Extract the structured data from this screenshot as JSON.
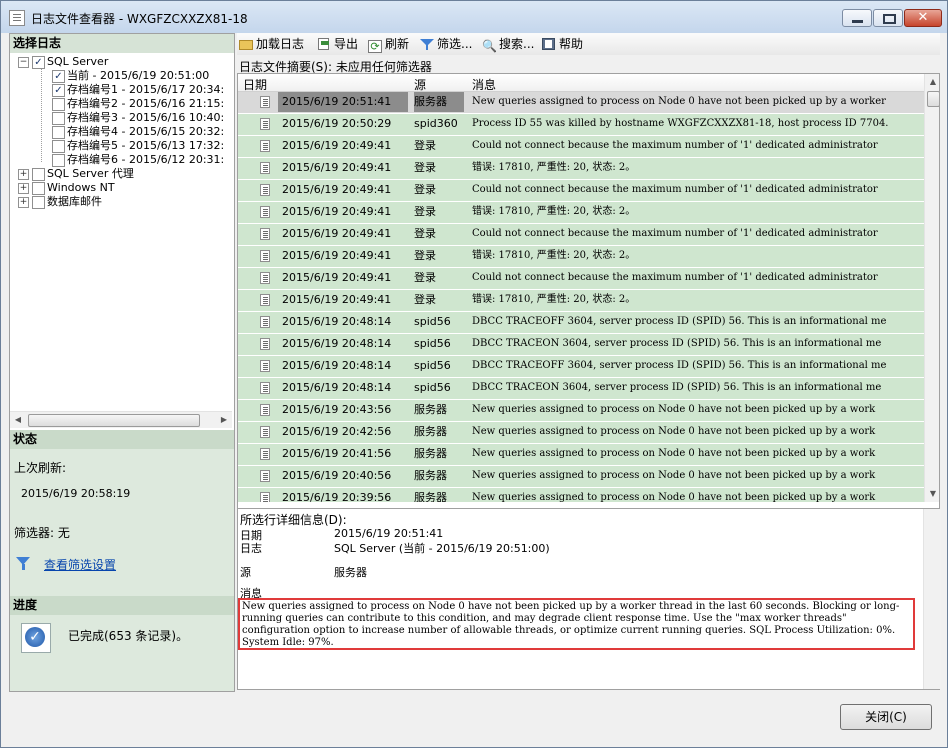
{
  "window": {
    "title": "日志文件查看器 - WXGFZCXXZX81-18"
  },
  "left": {
    "select_log_header": "选择日志",
    "tree": [
      {
        "label": "SQL Server",
        "checked": true,
        "expander": "−"
      },
      {
        "label": "当前 - 2015/6/19 20:51:00",
        "checked": true
      },
      {
        "label": "存档编号1 - 2015/6/17 20:34:",
        "checked": true
      },
      {
        "label": "存档编号2 - 2015/6/16 21:15:",
        "checked": false
      },
      {
        "label": "存档编号3 - 2015/6/16 10:40:",
        "checked": false
      },
      {
        "label": "存档编号4 - 2015/6/15 20:32:",
        "checked": false
      },
      {
        "label": "存档编号5 - 2015/6/13 17:32:",
        "checked": false
      },
      {
        "label": "存档编号6 - 2015/6/12 20:31:",
        "checked": false
      },
      {
        "label": "SQL Server 代理",
        "checked": false,
        "expander": "+"
      },
      {
        "label": "Windows NT",
        "checked": false,
        "expander": "+"
      },
      {
        "label": "数据库邮件",
        "checked": false,
        "expander": "+"
      }
    ],
    "status_header": "状态",
    "last_refresh_label": "上次刷新:",
    "last_refresh_value": "2015/6/19 20:58:19",
    "filter_label": "筛选器: 无",
    "view_filter_link": "查看筛选设置",
    "progress_header": "进度",
    "progress_text": "已完成(653 条记录)。"
  },
  "toolbar": {
    "load_log": "加载日志",
    "export": "导出",
    "refresh": "刷新",
    "filter": "筛选...",
    "search": "搜索...",
    "help": "帮助"
  },
  "summary_label": "日志文件摘要(S): 未应用任何筛选器",
  "columns": {
    "date": "日期",
    "source": "源",
    "message": "消息"
  },
  "rows": [
    {
      "date": "2015/6/19 20:51:41",
      "source": "服务器",
      "message": "New queries assigned to process on Node 0 have not been picked up by a worker"
    },
    {
      "date": "2015/6/19 20:50:29",
      "source": "spid360",
      "message": "Process ID 55 was killed by hostname WXGFZCXXZX81-18, host process ID 7704."
    },
    {
      "date": "2015/6/19 20:49:41",
      "source": "登录",
      "message": "Could not connect because the maximum number of '1' dedicated administrator"
    },
    {
      "date": "2015/6/19 20:49:41",
      "source": "登录",
      "message": "错误: 17810, 严重性: 20, 状态: 2。"
    },
    {
      "date": "2015/6/19 20:49:41",
      "source": "登录",
      "message": "Could not connect because the maximum number of '1' dedicated administrator"
    },
    {
      "date": "2015/6/19 20:49:41",
      "source": "登录",
      "message": "错误: 17810, 严重性: 20, 状态: 2。"
    },
    {
      "date": "2015/6/19 20:49:41",
      "source": "登录",
      "message": "Could not connect because the maximum number of '1' dedicated administrator"
    },
    {
      "date": "2015/6/19 20:49:41",
      "source": "登录",
      "message": "错误: 17810, 严重性: 20, 状态: 2。"
    },
    {
      "date": "2015/6/19 20:49:41",
      "source": "登录",
      "message": "Could not connect because the maximum number of '1' dedicated administrator"
    },
    {
      "date": "2015/6/19 20:49:41",
      "source": "登录",
      "message": "错误: 17810, 严重性: 20, 状态: 2。"
    },
    {
      "date": "2015/6/19 20:48:14",
      "source": "spid56",
      "message": "DBCC TRACEOFF 3604, server process ID (SPID) 56. This is an informational me"
    },
    {
      "date": "2015/6/19 20:48:14",
      "source": "spid56",
      "message": "DBCC TRACEON 3604, server process ID (SPID) 56. This is an informational me"
    },
    {
      "date": "2015/6/19 20:48:14",
      "source": "spid56",
      "message": "DBCC TRACEOFF 3604, server process ID (SPID) 56. This is an informational me"
    },
    {
      "date": "2015/6/19 20:48:14",
      "source": "spid56",
      "message": "DBCC TRACEON 3604, server process ID (SPID) 56. This is an informational me"
    },
    {
      "date": "2015/6/19 20:43:56",
      "source": "服务器",
      "message": "New queries assigned to process on Node 0 have not been picked up by a work"
    },
    {
      "date": "2015/6/19 20:42:56",
      "source": "服务器",
      "message": "New queries assigned to process on Node 0 have not been picked up by a work"
    },
    {
      "date": "2015/6/19 20:41:56",
      "source": "服务器",
      "message": "New queries assigned to process on Node 0 have not been picked up by a work"
    },
    {
      "date": "2015/6/19 20:40:56",
      "source": "服务器",
      "message": "New queries assigned to process on Node 0 have not been picked up by a work"
    },
    {
      "date": "2015/6/19 20:39:56",
      "source": "服务器",
      "message": "New queries assigned to process on Node 0 have not been picked up by a work"
    }
  ],
  "detail": {
    "header": "所选行详细信息(D):",
    "date_label": "日期",
    "date_value": "2015/6/19 20:51:41",
    "log_label": "日志",
    "log_value": "SQL Server (当前 - 2015/6/19 20:51:00)",
    "source_label": "源",
    "source_value": "服务器",
    "message_label": "消息",
    "message_value": "New queries assigned to process on Node 0 have not been picked up by a worker thread in the last 60 seconds. Blocking or long-running queries can contribute to this condition, and may degrade client response time. Use the \"max worker threads\" configuration option to increase number of allowable threads, or optimize current running queries. SQL Process Utilization: 0%. System Idle: 97%."
  },
  "close_button": "关闭(C)",
  "colors": {
    "row_green": "#cfe6cf",
    "section_green": "#dde9dd",
    "highlight_red": "#e03a3a"
  }
}
